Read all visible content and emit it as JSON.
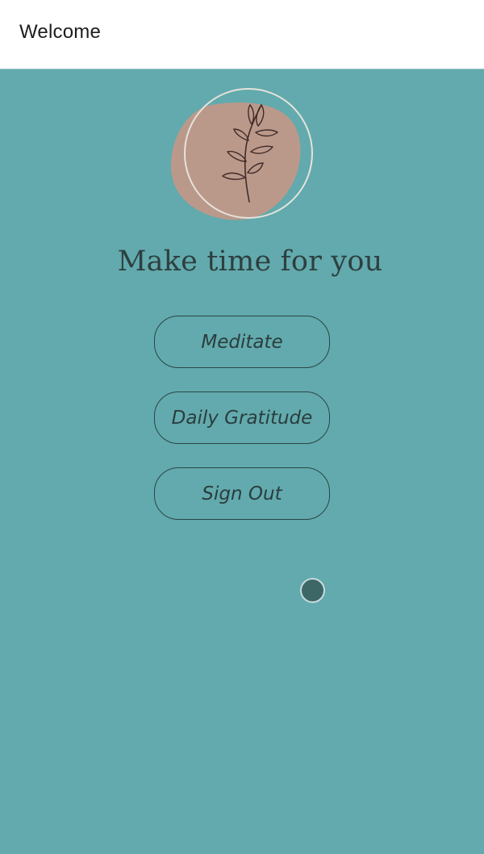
{
  "header": {
    "title": "Welcome"
  },
  "logo": {
    "icon": "leafy-sprig-icon",
    "blob_color": "#bb998a",
    "ring_color": "#e5e3dc",
    "line_color": "#3f2b29"
  },
  "hero": {
    "tagline": "Make time for you"
  },
  "actions": {
    "meditate_label": "Meditate",
    "gratitude_label": "Daily Gratitude",
    "signout_label": "Sign Out"
  },
  "colors": {
    "background": "#62aaad",
    "header_background": "#ffffff",
    "button_border": "#2c4547",
    "indicator": "#3d6767"
  }
}
